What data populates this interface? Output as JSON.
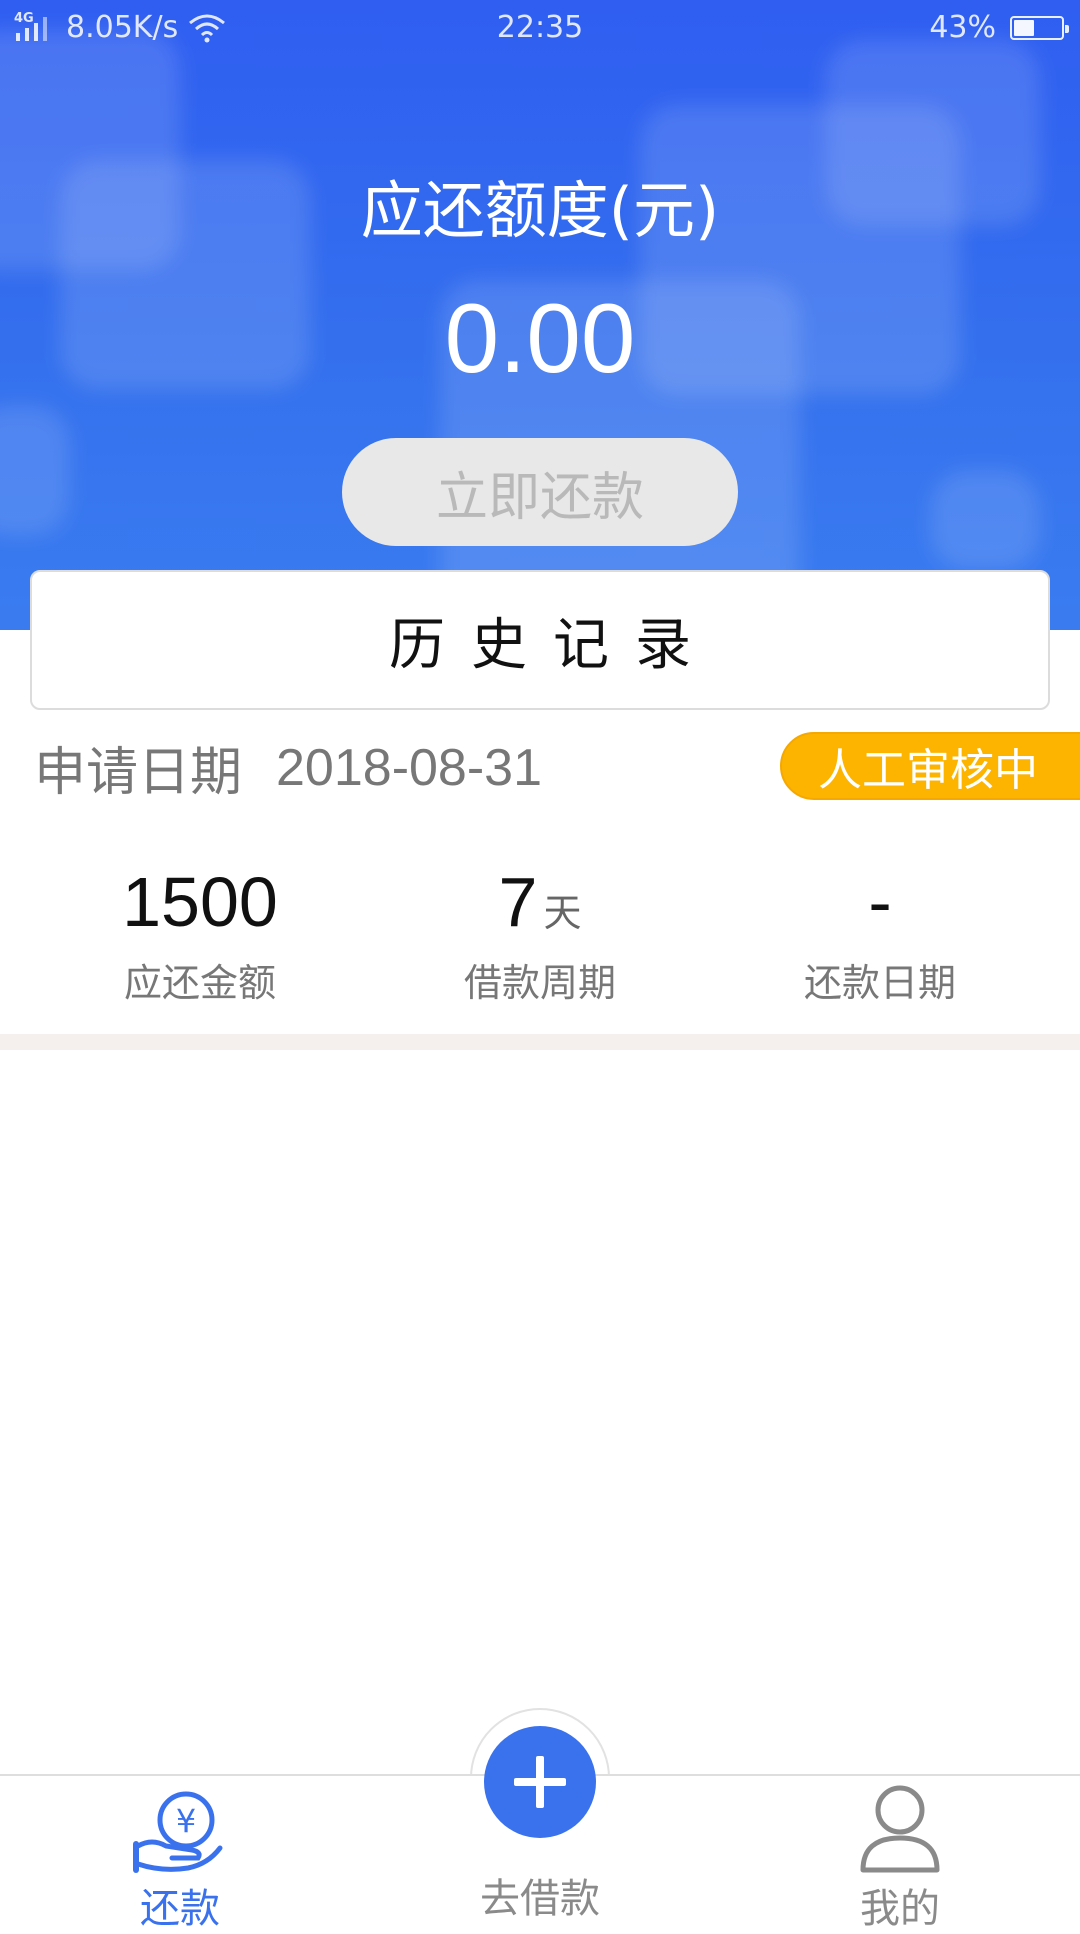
{
  "status_bar": {
    "network": "4G",
    "speed": "8.05K/s",
    "time": "22:35",
    "battery_percent": "43%",
    "battery_level": 0.43
  },
  "header": {
    "title": "应还额度(元)",
    "amount": "0.00",
    "repay_button": "立即还款"
  },
  "history": {
    "label": "历史记录"
  },
  "record": {
    "date_label": "申请日期",
    "date": "2018-08-31",
    "status": "人工审核中",
    "stats": [
      {
        "value": "1500",
        "unit": "",
        "label": "应还金额"
      },
      {
        "value": "7",
        "unit": "天",
        "label": "借款周期"
      },
      {
        "value": "-",
        "unit": "",
        "label": "还款日期"
      }
    ]
  },
  "tabs": [
    {
      "label": "还款",
      "icon": "repay-hand-yen-icon",
      "active": true
    },
    {
      "label": "去借款",
      "icon": "plus-icon",
      "active": false
    },
    {
      "label": "我的",
      "icon": "user-icon",
      "active": false
    }
  ],
  "colors": {
    "primary": "#3a72ee",
    "header_bg": "#2f5ef1",
    "badge": "#fdb400",
    "tab_active": "#3a72ee",
    "tab_inactive": "#8a8a8a"
  }
}
